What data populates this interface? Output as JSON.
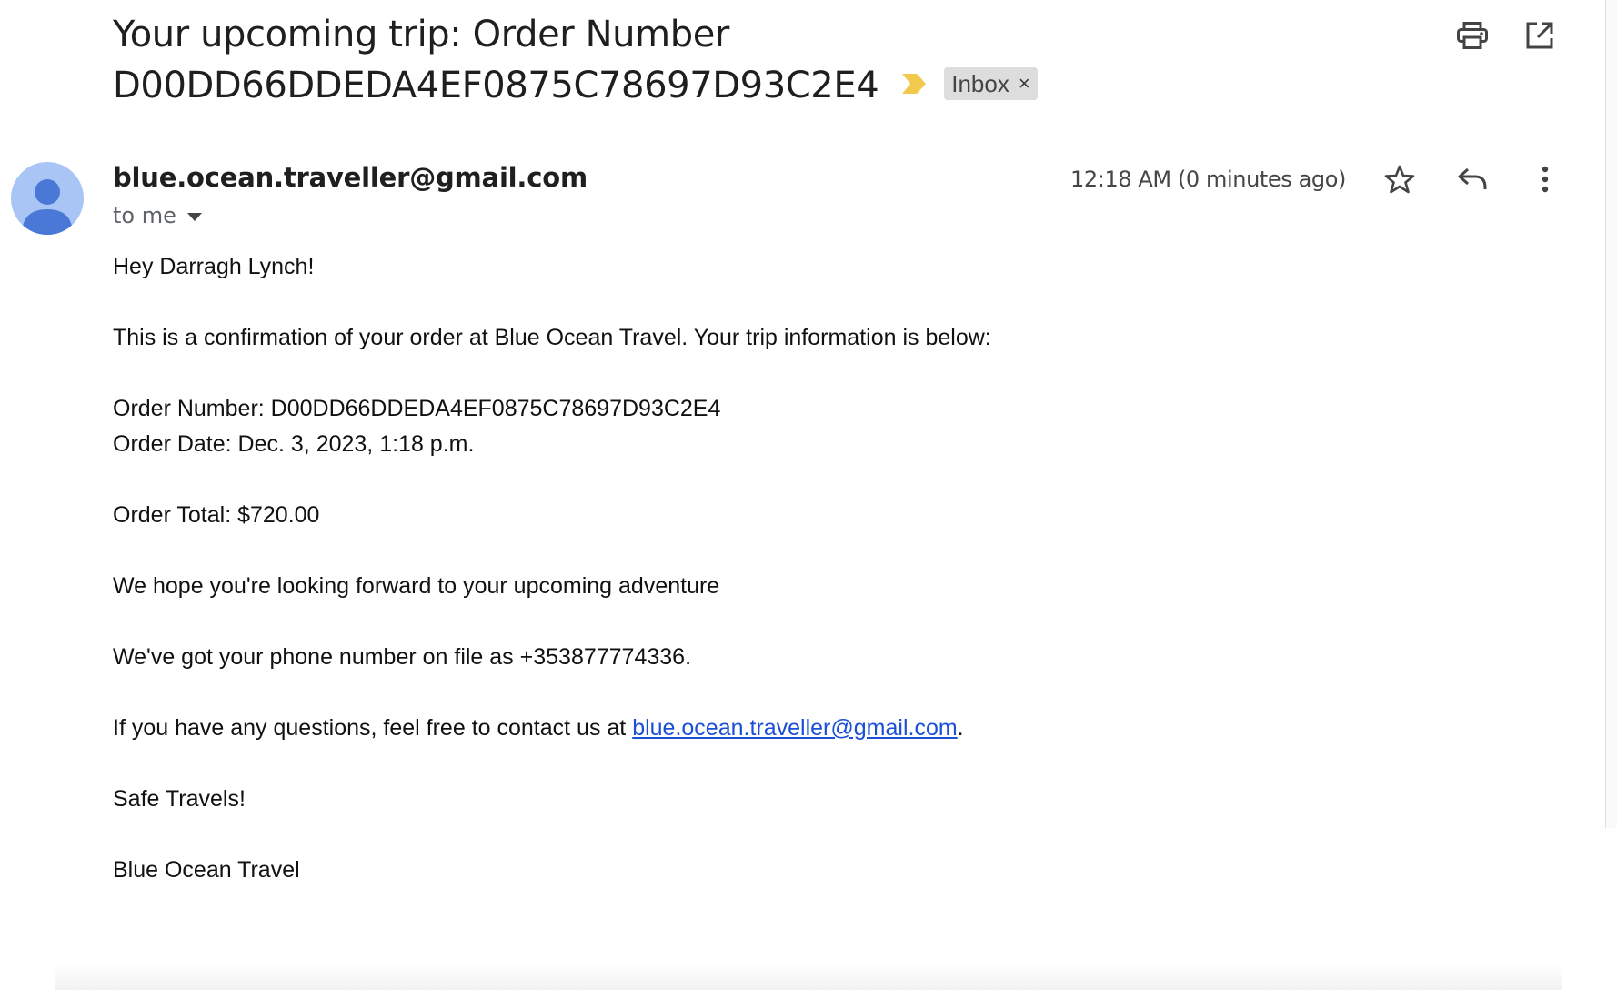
{
  "email": {
    "subject_line1": "Your upcoming trip: Order Number",
    "subject_line2": "D00DD66DDEDA4EF0875C78697D93C2E4",
    "label": "Inbox",
    "label_remove": "×",
    "sender": "blue.ocean.traveller@gmail.com",
    "recipient": "to me",
    "timestamp": "12:18 AM (0 minutes ago)",
    "body": {
      "greeting": "Hey Darragh Lynch!",
      "intro": "This is a confirmation of your order at Blue Ocean Travel. Your trip information is below:",
      "order_number": "Order Number: D00DD66DDEDA4EF0875C78697D93C2E4",
      "order_date": "Order Date: Dec. 3, 2023, 1:18 p.m.",
      "order_total": "Order Total: $720.00",
      "hope": "We hope you're looking forward to your upcoming adventure",
      "phone": "We've got your phone number on file as +353877774336.",
      "contact_prefix": "If you have any questions, feel free to contact us at ",
      "contact_email": "blue.ocean.traveller@gmail.com",
      "contact_suffix": ".",
      "signoff": "Safe Travels!",
      "signature": "Blue Ocean Travel"
    }
  },
  "icons": {
    "print": "print-icon",
    "open_new_window": "open-in-new-icon",
    "importance": "importance-marker-icon",
    "star": "star-icon",
    "reply": "reply-icon",
    "more": "more-vert-icon",
    "avatar": "person-icon"
  },
  "colors": {
    "importance": "#f2c94c",
    "link": "#1a4fd6",
    "avatar_bg": "#a8c5f5",
    "avatar_fg": "#4a78d6",
    "label_chip": "#dddddd"
  }
}
